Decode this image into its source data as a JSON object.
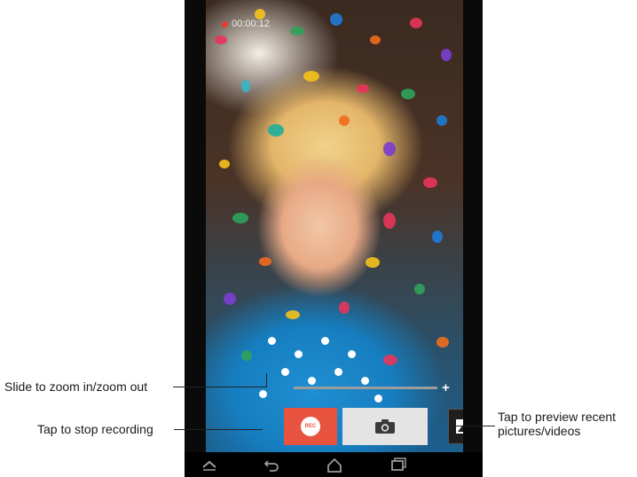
{
  "recording": {
    "elapsed": "00:00:12"
  },
  "zoom": {
    "level": 0.85,
    "plus_symbol": "+"
  },
  "controls": {
    "rec_label": "REC",
    "shutter_icon": "camera-icon",
    "gallery_icon": "image-gallery-icon"
  },
  "navbar": {
    "icons": [
      "up-arrow-icon",
      "back-icon",
      "home-icon",
      "recent-apps-icon"
    ]
  },
  "callouts": {
    "zoom": "Slide to zoom in/zoom out",
    "stop": "Tap to stop recording",
    "preview_line1": "Tap to preview recent",
    "preview_line2": "pictures/videos"
  },
  "colors": {
    "rec_button": "#e8533f",
    "shutter_button": "#e4e4e4",
    "rec_dot": "#e33b2e"
  }
}
